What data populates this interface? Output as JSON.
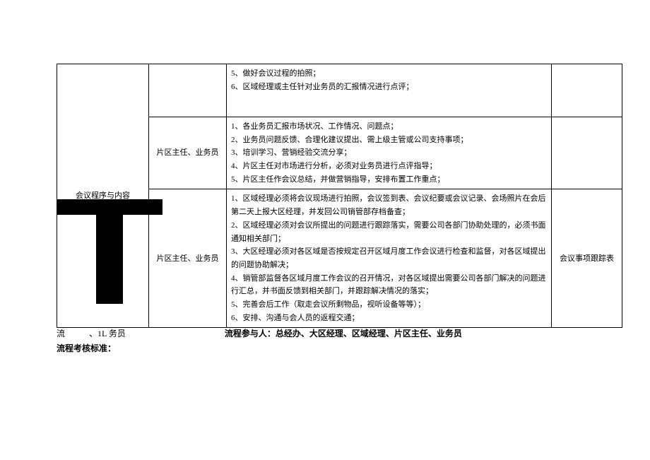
{
  "table": {
    "col1_label": "会议程序与内容",
    "rows": [
      {
        "col2": "",
        "col3": "5、做好会议过程的拍照；\n6、区域经理或主任针对业务员的汇报情况进行点评；",
        "col4": ""
      },
      {
        "col2": "片区主任、业务员",
        "col3": "1、各业务员汇报市场状况、工作情况、问题点；\n2、业务员问题反馈、合理化建议提出、需上级主管或公司支持事项；\n3、培训学习、营销经验交流分享；\n4、片区主任对市场进行分析，必须对业务员进行点评指导；\n5、片区主任作会议总结，并做营销指导，安排布置工作重点；",
        "col4": ""
      },
      {
        "col2": "片区主任、业务员",
        "col3": "1、区域经理必须将会议现场进行拍照，会议签到表、会议纪要或会议记录、会场照片在会后第二天上报大区经理，并发回公司销管部存档备查；\n2、区域经理必须对会议所提出的问题进行跟踪落实，需要公司各部门协助处理的，必须书面通知相关部门；\n3、大区经理必须对各区域是否按规定召开区域月度工作会议进行检查和监督，对各区域提出的问题协助解决；\n4、销管部监督各区域月度工作会议的召开情况，对各区域提出需要公司各部门解决的问题进行汇总，并书面反馈到相关部门，并跟踪解决情况的落实；\n5、完善会后工作（取走会议所剩物品，视听设备等等）；\n6、安排、沟通与会人员的返程交通；",
        "col4": "会议事项跟踪表"
      }
    ]
  },
  "footer": {
    "line1_left": "流",
    "line1_mid": "、1L 务员",
    "line1_right_label": "流程参与人：",
    "line1_right_value": "总经办、大区经理、区域经理、片区主任、业务员",
    "line2": "流程考核标准："
  }
}
